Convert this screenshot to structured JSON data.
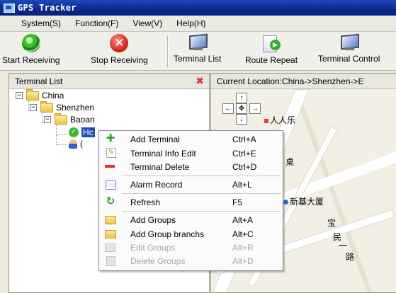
{
  "window": {
    "title": "GPS Tracker"
  },
  "menubar": [
    {
      "label": "System(S)"
    },
    {
      "label": "Function(F)"
    },
    {
      "label": "View(V)"
    },
    {
      "label": "Help(H)"
    }
  ],
  "toolbar": {
    "start_receiving": "Start Receiving",
    "stop_receiving": "Stop Receiving",
    "terminal_list": "Terminal List",
    "route_repeat": "Route Repeat",
    "terminal_control": "Terminal Control"
  },
  "left_panel": {
    "title": "Terminal List",
    "tree": {
      "root": "China",
      "level1": "Shenzhen",
      "level2": "Baoan",
      "leaf1": "Hc",
      "leaf2": "("
    }
  },
  "right_panel": {
    "title": "Current Location:China->Shenzhen->E"
  },
  "map": {
    "labels": [
      "人人乐",
      "新基大厦",
      "宝",
      "民",
      "一",
      "路",
      "桌"
    ]
  },
  "context_menu": {
    "items": [
      {
        "label": "Add Terminal",
        "shortcut": "Ctrl+A",
        "icon": "plus-icon"
      },
      {
        "label": "Terminal Info Edit",
        "shortcut": "Ctrl+E",
        "icon": "edit-icon"
      },
      {
        "label": "Terminal Delete",
        "shortcut": "Ctrl+D",
        "icon": "minus-icon"
      },
      {
        "label": "Alarm Record",
        "shortcut": "Alt+L",
        "icon": "record-icon"
      },
      {
        "label": "Refresh",
        "shortcut": "F5",
        "icon": "refresh-icon"
      },
      {
        "label": "Add Groups",
        "shortcut": "Alt+A",
        "icon": "folder-add-icon"
      },
      {
        "label": "Add Group branchs",
        "shortcut": "Alt+C",
        "icon": "folder-icon"
      },
      {
        "label": "Edit Groups",
        "shortcut": "Alt+R",
        "icon": "folder-edit-icon"
      },
      {
        "label": "Delete Groups",
        "shortcut": "Alt+D",
        "icon": "folder-delete-icon"
      }
    ]
  },
  "colors": {
    "titlebar": "#0a2a8a",
    "accent_red": "#d11a10",
    "accent_green": "#2fae2a"
  }
}
